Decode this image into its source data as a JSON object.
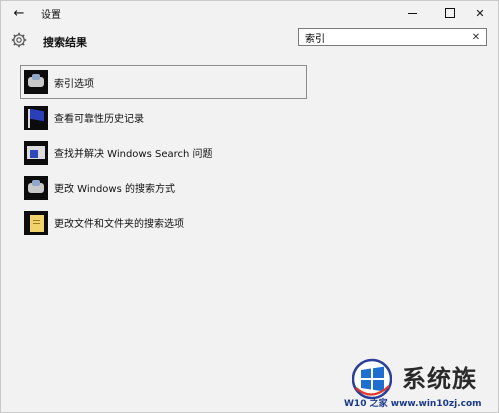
{
  "window": {
    "title": "设置"
  },
  "header": {
    "page_title": "搜索结果"
  },
  "search": {
    "value": "索引",
    "placeholder": ""
  },
  "results": [
    {
      "label": "索引选项",
      "icon": "indexing-options-icon"
    },
    {
      "label": "查看可靠性历史记录",
      "icon": "reliability-flag-icon"
    },
    {
      "label": "查找并解决 Windows Search 问题",
      "icon": "troubleshoot-icon"
    },
    {
      "label": "更改 Windows 的搜索方式",
      "icon": "search-settings-icon"
    },
    {
      "label": "更改文件和文件夹的搜索选项",
      "icon": "folder-options-icon"
    }
  ],
  "watermark": {
    "brand": "系统族",
    "url_part1": "W10",
    "url_part2": "之家",
    "url_part3": "www.win10zj.com"
  },
  "colors": {
    "background": "#f2f2f2",
    "selection_border": "#8c8c8c",
    "flag_blue": "#2b3fb8"
  }
}
